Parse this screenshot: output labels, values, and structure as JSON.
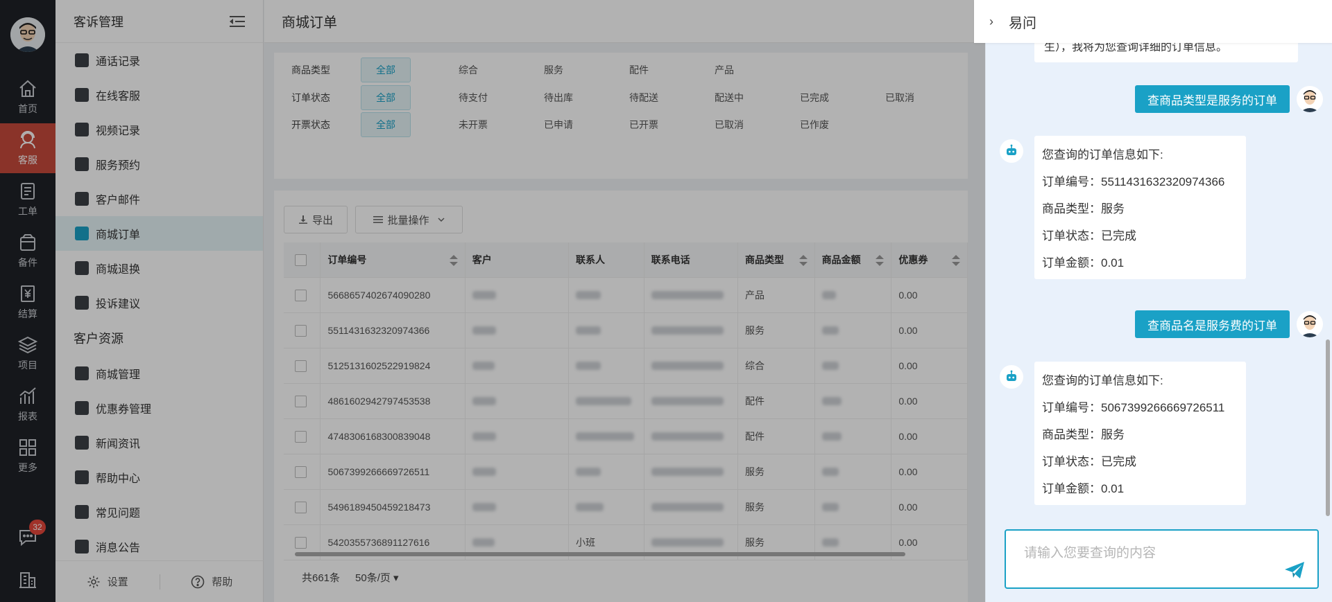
{
  "rail": {
    "items": [
      {
        "label": "首页",
        "icon": "home-icon"
      },
      {
        "label": "客服",
        "icon": "headset-icon"
      },
      {
        "label": "工单",
        "icon": "ticket-icon"
      },
      {
        "label": "备件",
        "icon": "box-icon"
      },
      {
        "label": "结算",
        "icon": "yen-icon"
      },
      {
        "label": "项目",
        "icon": "layers-icon"
      },
      {
        "label": "报表",
        "icon": "chart-icon"
      },
      {
        "label": "更多",
        "icon": "grid-icon"
      }
    ],
    "message_badge": "32",
    "active_color": "#c64a3c"
  },
  "sidebar": {
    "group1_title": "客诉管理",
    "group1_items": [
      {
        "label": "通话记录"
      },
      {
        "label": "在线客服"
      },
      {
        "label": "视频记录"
      },
      {
        "label": "服务预约"
      },
      {
        "label": "客户邮件"
      },
      {
        "label": "商城订单"
      },
      {
        "label": "商城退换"
      },
      {
        "label": "投诉建议"
      }
    ],
    "group2_title": "客户资源",
    "group2_items": [
      {
        "label": "商城管理"
      },
      {
        "label": "优惠券管理"
      },
      {
        "label": "新闻资讯"
      },
      {
        "label": "帮助中心"
      },
      {
        "label": "常见问题"
      },
      {
        "label": "消息公告"
      }
    ],
    "settings_label": "设置",
    "help_label": "帮助"
  },
  "main": {
    "title": "商城订单",
    "filters": [
      {
        "label": "商品类型",
        "options": [
          "全部",
          "综合",
          "服务",
          "配件",
          "产品"
        ]
      },
      {
        "label": "订单状态",
        "options": [
          "全部",
          "待支付",
          "待出库",
          "待配送",
          "配送中",
          "已完成",
          "已取消"
        ]
      },
      {
        "label": "开票状态",
        "options": [
          "全部",
          "未开票",
          "已申请",
          "已开票",
          "已取消",
          "已作废"
        ]
      }
    ],
    "export_label": "导出",
    "batch_label": "批量操作",
    "columns": [
      "订单编号",
      "客户",
      "联系人",
      "联系电话",
      "商品类型",
      "商品金额",
      "优惠券"
    ],
    "rows": [
      {
        "order": "5668657402674090280",
        "contact": "",
        "type": "产品",
        "coupon": "0.00"
      },
      {
        "order": "5511431632320974366",
        "contact": "",
        "type": "服务",
        "coupon": "0.00"
      },
      {
        "order": "5125131602522919824",
        "contact": "",
        "type": "综合",
        "coupon": "0.00"
      },
      {
        "order": "4861602942797453538",
        "contact": "",
        "type": "配件",
        "coupon": "0.00"
      },
      {
        "order": "4748306168300839048",
        "contact": "",
        "type": "配件",
        "coupon": "0.00"
      },
      {
        "order": "5067399266669726511",
        "contact": "",
        "type": "服务",
        "coupon": "0.00"
      },
      {
        "order": "5496189450459218473",
        "contact": "",
        "type": "服务",
        "coupon": "0.00"
      },
      {
        "order": "5420355736891127616",
        "contact": "小班",
        "type": "服务",
        "coupon": "0.00"
      }
    ],
    "total": "共661条",
    "page_size": "50条/页"
  },
  "chat": {
    "title": "易问",
    "prev_bubble_text": "生），我将为您查询详细的订单信息。",
    "messages": [
      {
        "role": "user",
        "text": "查商品类型是服务的订单"
      },
      {
        "role": "bot",
        "lines": [
          "您查询的订单信息如下:",
          "订单编号：5511431632320974366",
          "商品类型：服务",
          "订单状态：已完成",
          "订单金额：0.01"
        ]
      },
      {
        "role": "user",
        "text": "查商品名是服务费的订单"
      },
      {
        "role": "bot",
        "lines": [
          "您查询的订单信息如下:",
          "订单编号：5067399266669726511",
          "商品类型：服务",
          "订单状态：已完成",
          "订单金额：0.01"
        ]
      }
    ],
    "input_placeholder": "请输入您要查询的内容",
    "accent": "#1aa1c6"
  }
}
